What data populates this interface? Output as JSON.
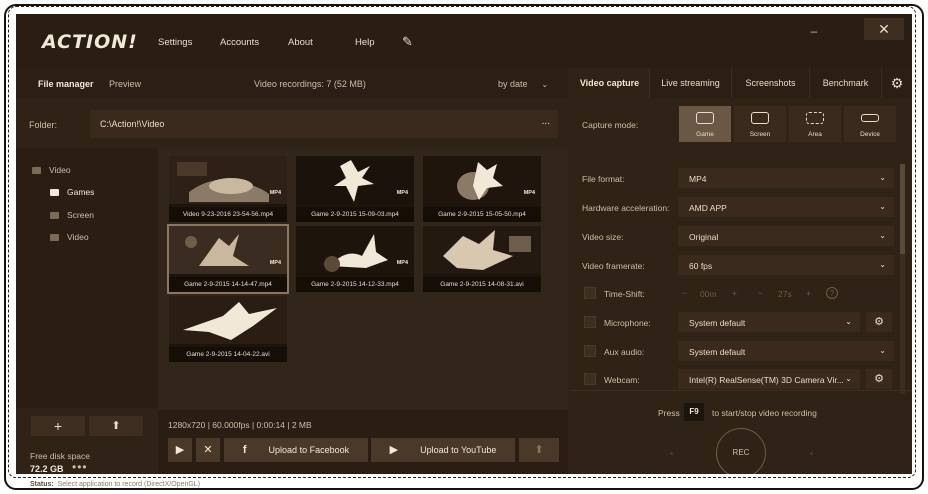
{
  "app": {
    "logo": "ACTION!",
    "menu": [
      "Settings",
      "Accounts",
      "About",
      "Help"
    ]
  },
  "left": {
    "tabs": [
      "File manager",
      "Preview"
    ],
    "recordings_count": "Video recordings: 7 (52 MB)",
    "sort": "by date",
    "folder_label": "Folder:",
    "folder_path": "C:\\Action!\\Video",
    "folder_more": "...",
    "tree": {
      "root": "Video",
      "children": [
        "Games",
        "Screen",
        "Video"
      ]
    },
    "free_disk_label": "Free disk space",
    "free_disk_value": "72.2 GB",
    "thumbnails": [
      {
        "caption": "Video 9-23-2016 23-54-56.mp4",
        "badge": "MP4"
      },
      {
        "caption": "Game 2-9-2015 15-09-03.mp4",
        "badge": "MP4"
      },
      {
        "caption": "Game 2-9-2015 15-05-50.mp4",
        "badge": "MP4"
      },
      {
        "caption": "Game 2-9-2015 14-14-47.mp4",
        "badge": "MP4"
      },
      {
        "caption": "Game 2-9-2015 14-12-33.mp4",
        "badge": "MP4"
      },
      {
        "caption": "Game 2-9-2015 14-08-31.avi",
        "badge": ""
      },
      {
        "caption": "Game 2-9-2015 14-04-22.avi",
        "badge": ""
      }
    ],
    "file_info": "1280x720 | 60.000fps | 0:00:14 | 2 MB",
    "upload_facebook": "Upload to Facebook",
    "upload_youtube": "Upload to YouTube"
  },
  "right": {
    "tabs": [
      "Video capture",
      "Live streaming",
      "Screenshots",
      "Benchmark"
    ],
    "capture_mode_label": "Capture mode:",
    "modes": [
      "Game",
      "Screen",
      "Area",
      "Device"
    ],
    "rows": {
      "file_format": {
        "label": "File format:",
        "value": "MP4"
      },
      "hw_accel": {
        "label": "Hardware acceleration:",
        "value": "AMD APP"
      },
      "video_size": {
        "label": "Video size:",
        "value": "Original"
      },
      "framerate": {
        "label": "Video framerate:",
        "value": "60 fps"
      },
      "timeshift": {
        "label": "Time-Shift:",
        "minutes": "00m",
        "seconds": "27s"
      },
      "microphone": {
        "label": "Microphone:",
        "value": "System default"
      },
      "aux": {
        "label": "Aux audio:",
        "value": "System default"
      },
      "webcam": {
        "label": "Webcam:",
        "value": "Intel(R) RealSense(TM) 3D Camera Vir..."
      }
    },
    "press_text": "Press",
    "hotkey": "F9",
    "hotkey_text": "to start/stop video recording",
    "rec_label": "REC"
  },
  "status": {
    "label": "Status:",
    "text": "Select application to record (DirectX/OpenGL)"
  },
  "colors": {
    "background": "#2f2217",
    "panel_dark": "#2a1d13",
    "accent_text": "#f2e8d8"
  }
}
